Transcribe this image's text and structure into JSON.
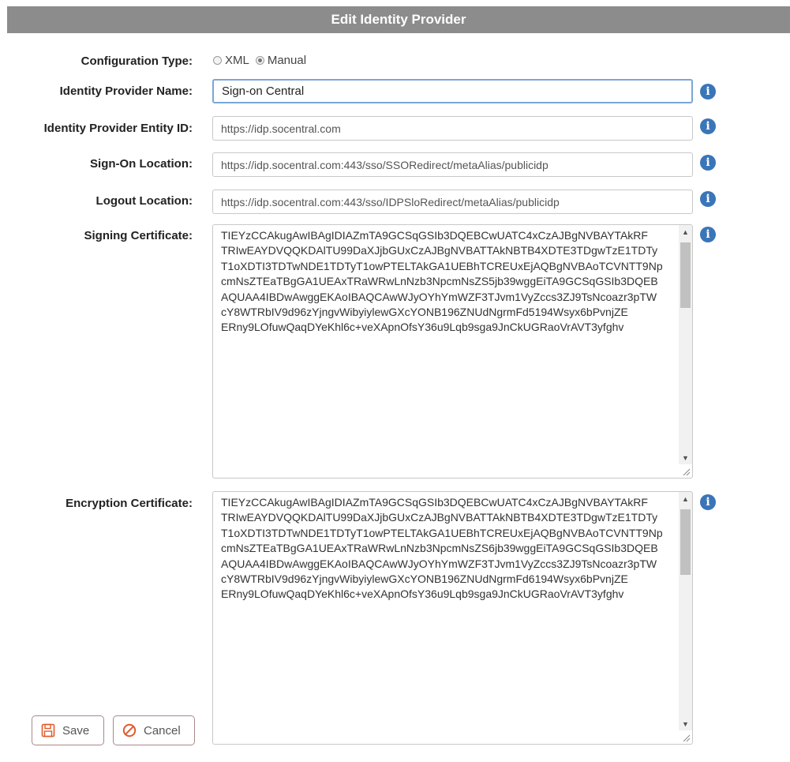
{
  "dialog": {
    "title": "Edit Identity Provider"
  },
  "form": {
    "config_type": {
      "label": "Configuration Type:",
      "options": [
        "XML",
        "Manual"
      ],
      "selected": "Manual"
    },
    "idp_name": {
      "label": "Identity Provider Name:",
      "value": "Sign-on Central"
    },
    "entity_id": {
      "label": "Identity Provider Entity ID:",
      "value": "https://idp.socentral.com"
    },
    "signon_location": {
      "label": "Sign-On Location:",
      "value": "https://idp.socentral.com:443/sso/SSORedirect/metaAlias/publicidp"
    },
    "logout_location": {
      "label": "Logout Location:",
      "value": "https://idp.socentral.com:443/sso/IDPSloRedirect/metaAlias/publicidp"
    },
    "signing_cert": {
      "label": "Signing Certificate:",
      "value": "TIEYzCCAkugAwIBAgIDIAZmTA9GCSqGSIb3DQEBCwUATC4xCzAJBgNVBAYTAkRF\nTRIwEAYDVQQKDAlTU99DaXJjbGUxCzAJBgNVBATTAkNBTB4XDTE3TDgwTzE1TDTy\nT1oXDTI3TDTwNDE1TDTyT1owPTELTAkGA1UEBhTCREUxEjAQBgNVBAoTCVNTT9Np\ncmNsZTEaTBgGA1UEAxTRaWRwLnNzb3NpcmNsZS5jb39wggEiTA9GCSqGSIb3DQEB\nAQUAA4IBDwAwggEKAoIBAQCAwWJyOYhYmWZF3TJvm1VyZccs3ZJ9TsNcoazr3pTW\ncY8WTRbIV9d96zYjngvWibyiylewGXcYONB196ZNUdNgrmFd5194Wsyx6bPvnjZE\nERny9LOfuwQaqDYeKhl6c+veXApnOfsY36u9Lqb9sga9JnCkUGRaoVrAVT3yfghv"
    },
    "encryption_cert": {
      "label": "Encryption Certificate:",
      "value": "TIEYzCCAkugAwIBAgIDIAZmTA9GCSqGSIb3DQEBCwUATC4xCzAJBgNVBAYTAkRF\nTRIwEAYDVQQKDAlTU99DaXJjbGUxCzAJBgNVBATTAkNBTB4XDTE3TDgwTzE1TDTy\nT1oXDTI3TDTwNDE1TDTyT1owPTELTAkGA1UEBhTCREUxEjAQBgNVBAoTCVNTT9Np\ncmNsZTEaTBgGA1UEAxTRaWRwLnNzb3NpcmNsZS6jb39wggEiTA9GCSqGSIb3DQEB\nAQUAA4IBDwAwggEKAoIBAQCAwWJyOYhYmWZF3TJvm1VyZccs3ZJ9TsNcoazr3pTW\ncY8WTRbIV9d96zYjngvWibyiylewGXcYONB196ZNUdNgrmFd6194Wsyx6bPvnjZE\nERny9LOfuwQaqDYeKhl6c+veXApnOfsY36u9Lqb9sga9JnCkUGRaoVrAVT3yfghv"
    }
  },
  "buttons": {
    "save": "Save",
    "cancel": "Cancel"
  },
  "colors": {
    "header_bg": "#8c8c8c",
    "info_icon": "#3a75b8",
    "focus_border": "#7aa7d6",
    "cancel_icon": "#e05a2b",
    "save_icon": "#e05a2b"
  }
}
